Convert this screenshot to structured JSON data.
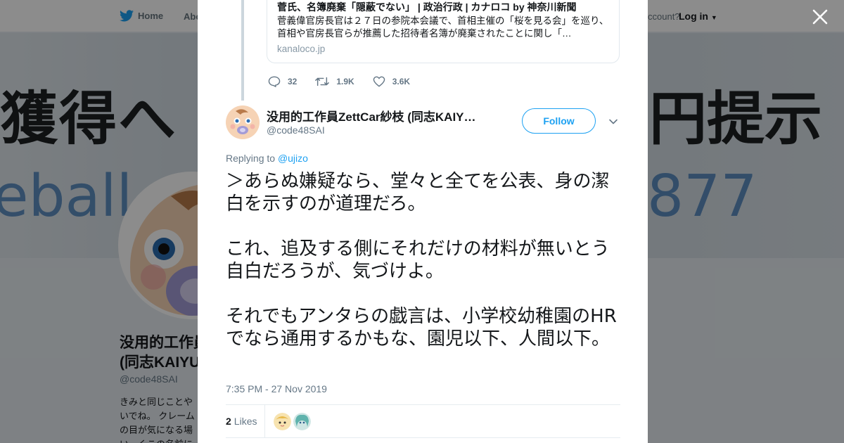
{
  "topbar": {
    "home_label": "Home",
    "about_label": "Abo",
    "account_prompt": "ccount?",
    "login_label": "Log in"
  },
  "banner": {
    "text_left": "獲得へ",
    "text_right": "円提示",
    "text_left2": "eball-n",
    "text_right2": "877"
  },
  "profile": {
    "name_line1": "没用的工作員",
    "name_line2": "(同志KAIYU",
    "handle": "@code48SAI",
    "bio_lines": [
      "きみと同じことや",
      "いでね。 クレーム",
      "の目が気になる場",
      "い…くこの名前に"
    ]
  },
  "quoted_card": {
    "title": "菅氏、名簿廃棄「隠蔽でない」 | 政治行政 | カナロコ by 神奈川新聞",
    "description": "菅義偉官房長官は２７日の参院本会議で、首相主催の「桜を見る会」を巡り、首相や官房長官らが推薦した招待者名簿が廃棄されたことに関し「…",
    "domain": "kanaloco.jp"
  },
  "parent_actions": {
    "replies": "32",
    "retweets": "1.9K",
    "likes": "3.6K"
  },
  "tweet": {
    "author_name": "没用的工作員ZettCar紗枝 (同志KAIY…",
    "author_handle": "@code48SAI",
    "follow_label": "Follow",
    "replying_prefix": "Replying to",
    "replying_to": "@ujizo",
    "text": "＞あらぬ嫌疑なら、堂々と全てを公表、身の潔白を示すのが道理だろ。\n\nこれ、追及する側にそれだけの材料が無いとう自白だろうが、気づけよ。\n\nそれでもアンタらの戯言は、小学校幼稚園のHRでなら通用するかもな、園児以下、人間以下。",
    "timestamp": "7:35 PM - 27 Nov 2019",
    "likes_count": "2",
    "likes_label": "Likes"
  },
  "colors": {
    "twitter_blue": "#1da1f2",
    "text_primary": "#14171a",
    "text_secondary": "#657786"
  },
  "icons": {
    "brand": "twitter-bird-icon",
    "close": "close-icon",
    "reply": "reply-icon",
    "retweet": "retweet-icon",
    "like": "heart-icon",
    "menu": "chevron-down-icon"
  }
}
